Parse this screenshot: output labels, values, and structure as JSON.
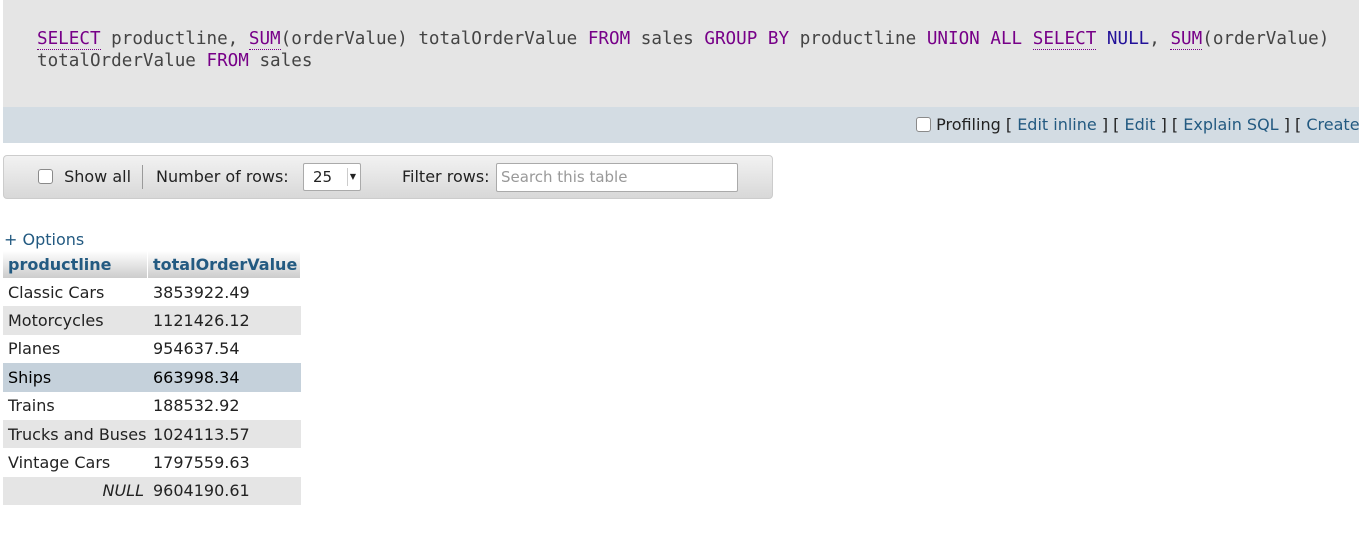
{
  "sql": {
    "line1": [
      {
        "t": "SELECT",
        "c": "fn-plain"
      },
      {
        "t": " productline, ",
        "c": ""
      },
      {
        "t": "SUM",
        "c": "fn"
      },
      {
        "t": "(orderValue) totalOrderValue ",
        "c": ""
      },
      {
        "t": "FROM",
        "c": "kw"
      },
      {
        "t": " sales ",
        "c": ""
      },
      {
        "t": "GROUP BY",
        "c": "kw"
      },
      {
        "t": " productline ",
        "c": ""
      },
      {
        "t": "UNION ALL",
        "c": "kw"
      },
      {
        "t": " ",
        "c": ""
      },
      {
        "t": "SELECT",
        "c": "fn-plain"
      },
      {
        "t": " ",
        "c": ""
      },
      {
        "t": "NULL",
        "c": "nl"
      },
      {
        "t": ", ",
        "c": ""
      },
      {
        "t": "SUM",
        "c": "fn"
      },
      {
        "t": "(orderValue)",
        "c": ""
      }
    ],
    "line2": [
      {
        "t": "totalOrderValue ",
        "c": ""
      },
      {
        "t": "FROM",
        "c": "kw"
      },
      {
        "t": " sales",
        "c": ""
      }
    ]
  },
  "toolbar": {
    "profiling_label": "Profiling",
    "open_bracket": "[",
    "close_bracket": "]",
    "edit_inline": "Edit inline",
    "edit": "Edit",
    "explain_sql": "Explain SQL",
    "create": "Create"
  },
  "nav": {
    "show_all_label": "Show all",
    "rows_label": "Number of rows:",
    "rows_value": "25",
    "filter_label": "Filter rows:",
    "filter_placeholder": "Search this table"
  },
  "options_link": "+ Options",
  "table": {
    "columns": [
      "productline",
      "totalOrderValue"
    ],
    "rows": [
      {
        "productline": "Classic Cars",
        "total": "3853922.49",
        "style": "odd"
      },
      {
        "productline": "Motorcycles",
        "total": "1121426.12",
        "style": "even"
      },
      {
        "productline": "Planes",
        "total": "954637.54",
        "style": "odd"
      },
      {
        "productline": "Ships",
        "total": "663998.34",
        "style": "marked"
      },
      {
        "productline": "Trains",
        "total": "188532.92",
        "style": "odd"
      },
      {
        "productline": "Trucks and Buses",
        "total": "1024113.57",
        "style": "even"
      },
      {
        "productline": "Vintage Cars",
        "total": "1797559.63",
        "style": "odd"
      },
      {
        "productline": "NULL",
        "total": "9604190.61",
        "style": "even",
        "is_null": true
      }
    ]
  },
  "colors": {
    "link": "#235a81",
    "keyword": "#770088",
    "null_keyword": "#221199",
    "marked_row": "#c5d1db",
    "even_row": "#e5e5e5"
  }
}
